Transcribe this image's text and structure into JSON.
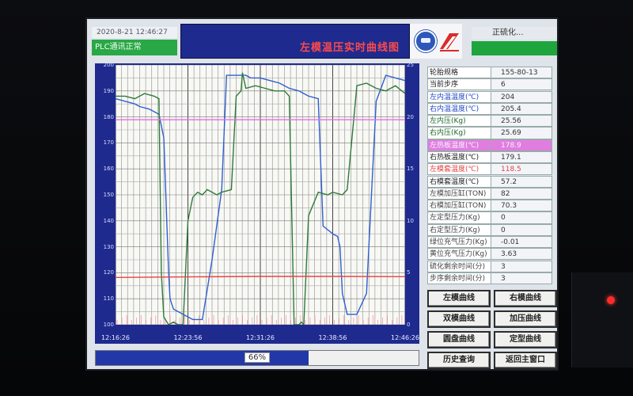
{
  "header": {
    "datetime": "2020-8-21 12:46:27",
    "plc_status": "PLC通讯正常",
    "title": "左模温压实时曲线图",
    "status_text": "正硫化..."
  },
  "chart_data": {
    "type": "line",
    "y_ticks_left": [
      "200",
      "190",
      "180",
      "170",
      "160",
      "150",
      "140",
      "130",
      "120",
      "110",
      "100"
    ],
    "y_ticks_right": [
      "25",
      "",
      "20",
      "",
      "15",
      "",
      "10",
      "",
      "5",
      "",
      "0"
    ],
    "x_ticks": [
      "12:16:26",
      "12:23:56",
      "12:31:26",
      "12:38:56",
      "12:46:26"
    ],
    "grid": true,
    "series": [
      {
        "color": "#2f5fd0",
        "x": [
          0,
          2,
          4,
          5,
          7,
          8,
          9,
          10,
          11,
          11.3,
          12,
          14,
          16,
          18,
          20,
          22,
          23,
          25,
          26,
          26.5,
          27,
          28,
          30,
          32,
          34,
          36,
          38,
          40,
          42,
          43,
          45,
          46,
          46.5,
          47,
          48,
          50,
          52,
          54,
          56,
          58,
          60
        ],
        "y": [
          187,
          186,
          185,
          184,
          183,
          182,
          181,
          172,
          120,
          110,
          106,
          104,
          102,
          102,
          125,
          152,
          196,
          196,
          196,
          196,
          196,
          195,
          195,
          194,
          193,
          191,
          190,
          188,
          187,
          138,
          135,
          134,
          130,
          112,
          104,
          104,
          112,
          186,
          196,
          195,
          194
        ]
      },
      {
        "color": "#2f7a3a",
        "x": [
          0,
          2,
          4,
          6,
          8,
          9,
          9.5,
          10,
          11,
          12,
          13,
          14,
          15,
          16,
          17,
          18,
          19,
          20,
          21,
          22,
          24,
          25,
          26,
          26.3,
          27,
          29,
          31,
          33,
          35,
          36,
          37,
          38,
          38.5,
          39,
          40,
          42,
          44,
          45,
          47,
          48,
          50,
          52,
          54,
          56,
          58,
          60
        ],
        "y": [
          188,
          188,
          187,
          189,
          188,
          187,
          120,
          103,
          100,
          101,
          100,
          100,
          140,
          149,
          151,
          150,
          152,
          151,
          150,
          151,
          152,
          188,
          190,
          197,
          191,
          192,
          191,
          190,
          190,
          188,
          100,
          100,
          101,
          100,
          142,
          151,
          150,
          151,
          150,
          152,
          192,
          193,
          191,
          190,
          192,
          189
        ]
      },
      {
        "color": "#e86be8",
        "x": [
          0,
          60
        ],
        "y": [
          178.9,
          178.9
        ]
      },
      {
        "color": "#e94444",
        "x": [
          0,
          15,
          30,
          45,
          60
        ],
        "y": [
          118.2,
          118.4,
          118.6,
          118.6,
          118.5
        ]
      }
    ],
    "x_range": [
      0,
      60
    ],
    "y_range": [
      100,
      200
    ]
  },
  "progress": {
    "label": "66%",
    "value": 0.66
  },
  "params": [
    {
      "label": "轮胎规格",
      "value": "155-80-13",
      "color": "#222",
      "bg": "#ffffff"
    },
    {
      "label": "当前步序",
      "value": "6",
      "color": "#222",
      "bg": "#ffffff"
    },
    {
      "label": "左内温温度(℃)",
      "value": "204",
      "color": "#2248c6",
      "bg": "#ffffff"
    },
    {
      "label": "右内温温度(℃)",
      "value": "205.4",
      "color": "#2248c6",
      "bg": "#ffffff"
    },
    {
      "label": "左内压(Kg)",
      "value": "25.56",
      "color": "#1e6a2a",
      "bg": "#ffffff"
    },
    {
      "label": "右内压(Kg)",
      "value": "25.69",
      "color": "#1e6a2a",
      "bg": "#ffffff"
    },
    {
      "label": "左热板温度(℃)",
      "value": "178.9",
      "color": "#f4f4ff",
      "bg": "#e27de0"
    },
    {
      "label": "右热板温度(℃)",
      "value": "179.1",
      "color": "#222",
      "bg": "#ffffff"
    },
    {
      "label": "左模套温度(℃)",
      "value": "118.5",
      "color": "#e24444",
      "bg": "#ffffff"
    },
    {
      "label": "右模套温度(℃)",
      "value": "57.2",
      "color": "#222",
      "bg": "#ffffff"
    },
    {
      "label": "左模加压缸(TON)",
      "value": "82",
      "color": "#444",
      "bg": "#ffffff"
    },
    {
      "label": "右模加压缸(TON)",
      "value": "70.3",
      "color": "#444",
      "bg": "#ffffff"
    },
    {
      "label": "左定型压力(Kg)",
      "value": "0",
      "color": "#444",
      "bg": "#ffffff"
    },
    {
      "label": "右定型压力(Kg)",
      "value": "0",
      "color": "#444",
      "bg": "#ffffff"
    },
    {
      "label": "绿位充气压力(Kg)",
      "value": "-0.01",
      "color": "#444",
      "bg": "#ffffff"
    },
    {
      "label": "黄位充气压力(Kg)",
      "value": "3.63",
      "color": "#444",
      "bg": "#ffffff"
    },
    {
      "label": "硫化剩余时间(分)",
      "value": "3",
      "color": "#444",
      "bg": "#ffffff"
    },
    {
      "label": "步序剩余时间(分)",
      "value": "3",
      "color": "#444",
      "bg": "#ffffff"
    }
  ],
  "buttons": [
    {
      "label": "左模曲线"
    },
    {
      "label": "右模曲线"
    },
    {
      "label": "双模曲线"
    },
    {
      "label": "加压曲线"
    },
    {
      "label": "圆盘曲线"
    },
    {
      "label": "定型曲线"
    },
    {
      "label": "历史查询"
    },
    {
      "label": "返回主窗口"
    }
  ],
  "colors": {
    "title_bg": "#1f2a8e",
    "title_text": "#ff4a4a",
    "plc_green": "#2aa746",
    "indicator_red": "#ff2a2a"
  }
}
